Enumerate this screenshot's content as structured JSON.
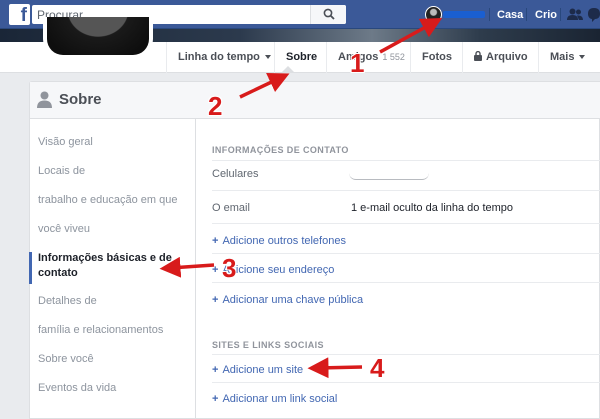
{
  "topbar": {
    "logo": "f",
    "search_placeholder": "Procurar",
    "links": [
      "Casa",
      "Crio"
    ]
  },
  "nav": {
    "items": [
      {
        "label": "Linha do tempo",
        "dropdown": true
      },
      {
        "label": "Sobre",
        "active": true
      },
      {
        "label": "Amigos",
        "count": "1 552"
      },
      {
        "label": "Fotos"
      },
      {
        "label": "Arquivo",
        "icon": "lock-icon"
      },
      {
        "label": "Mais",
        "dropdown": true
      }
    ]
  },
  "about": {
    "title": "Sobre",
    "sidebar": [
      {
        "label": "Visão geral"
      },
      {
        "label": "Locais de"
      },
      {
        "label": "trabalho e educação em que"
      },
      {
        "label": "você viveu"
      },
      {
        "label": "Informações básicas e de"
      },
      {
        "label": "contato"
      },
      {
        "label": "Detalhes de"
      },
      {
        "label": "família e relacionamentos"
      },
      {
        "label": "Sobre você"
      },
      {
        "label": "Eventos da vida"
      }
    ],
    "contact_section": {
      "title": "INFORMAÇÕES DE CONTATO",
      "fields": [
        {
          "label": "Celulares",
          "value": ""
        },
        {
          "label": "O email",
          "value": "1 e-mail oculto da linha do tempo"
        }
      ],
      "add_links": [
        "Adicione outros telefones",
        "Adicione seu endereço",
        "Adicionar uma chave pública"
      ]
    },
    "sites_section": {
      "title": "SITES E LINKS SOCIAIS",
      "add_links": [
        "Adicione um site",
        "Adicionar um link social"
      ]
    }
  },
  "annotations": {
    "numbers": [
      "1",
      "2",
      "3",
      "4"
    ],
    "color": "#d81b1b"
  },
  "colors": {
    "brand": "#3b5998",
    "link": "#4267b2"
  }
}
